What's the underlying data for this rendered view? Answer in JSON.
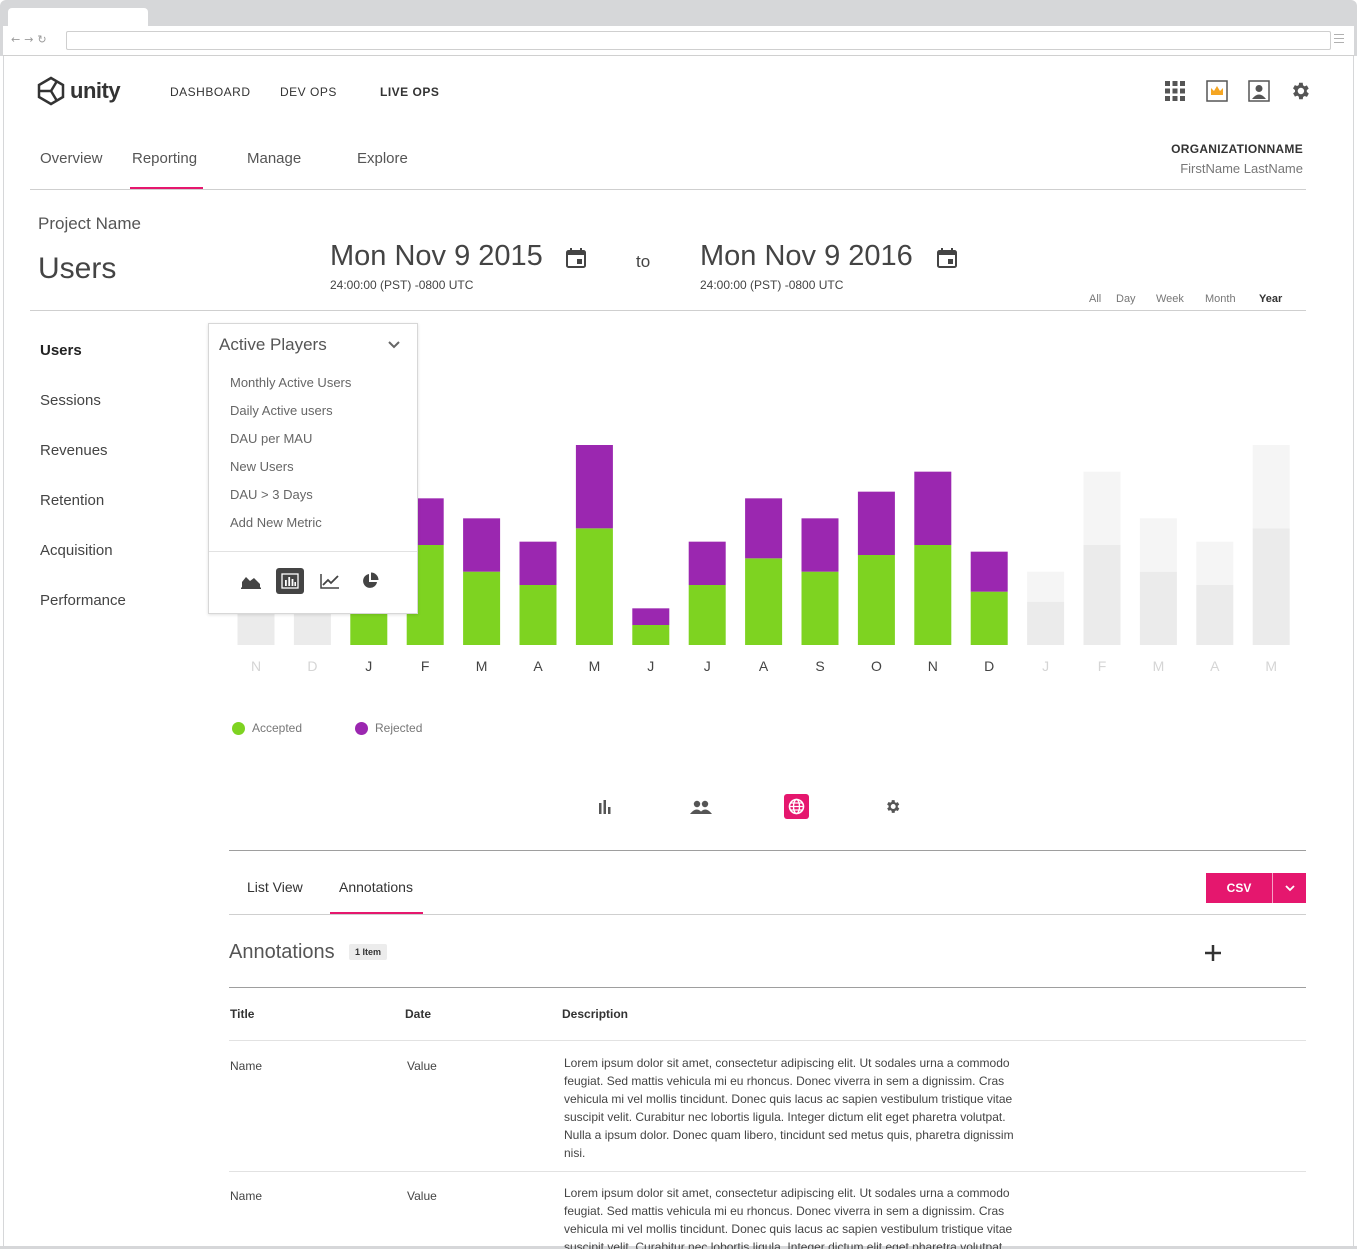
{
  "top_nav": {
    "logo_text": "unity",
    "items": [
      {
        "label": "DASHBOARD",
        "active": false
      },
      {
        "label": "DEV OPS",
        "active": false
      },
      {
        "label": "LIVE OPS",
        "active": true
      }
    ],
    "tools": [
      "apps-grid-icon",
      "crown-icon",
      "account-icon",
      "settings-gear-icon"
    ]
  },
  "sub_nav": {
    "items": [
      {
        "label": "Overview",
        "active": false
      },
      {
        "label": "Reporting",
        "active": true
      },
      {
        "label": "Manage",
        "active": false
      },
      {
        "label": "Explore",
        "active": false
      }
    ]
  },
  "org": {
    "name": "ORGANIZATIONNAME",
    "user": "FirstName LastName"
  },
  "page": {
    "project_name": "Project Name",
    "title": "Users"
  },
  "date_range": {
    "from_date": "Mon Nov 9 2015",
    "from_time": "24:00:00 (PST) -0800 UTC",
    "to_label": "to",
    "to_date": "Mon Nov 9 2016",
    "to_time": "24:00:00 (PST) -0800 UTC"
  },
  "range_options": [
    {
      "label": "All",
      "active": false
    },
    {
      "label": "Day",
      "active": false
    },
    {
      "label": "Week",
      "active": false
    },
    {
      "label": "Month",
      "active": false
    },
    {
      "label": "Year",
      "active": true
    }
  ],
  "sidebar": {
    "items": [
      {
        "label": "Users",
        "active": true
      },
      {
        "label": "Sessions",
        "active": false
      },
      {
        "label": "Revenues",
        "active": false
      },
      {
        "label": "Retention",
        "active": false
      },
      {
        "label": "Acquisition",
        "active": false
      },
      {
        "label": "Performance",
        "active": false
      }
    ]
  },
  "metric_dropdown": {
    "selected": "Active Players",
    "options": [
      "Monthly Active Users",
      "Daily Active users",
      "DAU per MAU",
      "New Users",
      "DAU > 3 Days",
      "Add New Metric"
    ],
    "chart_types": [
      {
        "icon": "area-chart-icon",
        "active": false
      },
      {
        "icon": "bar-chart-icon",
        "active": true
      },
      {
        "icon": "line-chart-icon",
        "active": false
      },
      {
        "icon": "pie-chart-icon",
        "active": false
      }
    ]
  },
  "chart_data": {
    "type": "bar",
    "stacked": true,
    "categories": [
      "N",
      "D",
      "J",
      "F",
      "M",
      "A",
      "M",
      "J",
      "J",
      "A",
      "S",
      "O",
      "N",
      "D",
      "J",
      "F",
      "M",
      "A",
      "M"
    ],
    "in_range": [
      false,
      false,
      true,
      true,
      true,
      true,
      true,
      true,
      true,
      true,
      true,
      true,
      true,
      true,
      false,
      false,
      false,
      false,
      false
    ],
    "series": [
      {
        "name": "Accepted",
        "color": "#7ed321",
        "values": [
          12,
          12,
          12,
          30,
          22,
          18,
          35,
          6,
          18,
          26,
          22,
          27,
          30,
          16,
          13,
          30,
          22,
          18,
          35
        ]
      },
      {
        "name": "Rejected",
        "color": "#9b27b0",
        "values": [
          0,
          0,
          0,
          14,
          16,
          13,
          25,
          5,
          13,
          18,
          16,
          19,
          22,
          12,
          9,
          22,
          16,
          13,
          25
        ]
      }
    ],
    "out_of_range_colors": {
      "lower": "#ebebeb",
      "upper": "#f5f5f5"
    },
    "ylim": [
      0,
      60
    ],
    "grid": false,
    "legend": "bottom-left"
  },
  "view_switch": [
    {
      "icon": "bar-chart-icon",
      "active": false
    },
    {
      "icon": "people-icon",
      "active": false
    },
    {
      "icon": "globe-icon",
      "active": true
    },
    {
      "icon": "settings-gear-icon",
      "active": false
    }
  ],
  "tabs": [
    {
      "label": "List View",
      "active": false
    },
    {
      "label": "Annotations",
      "active": true
    }
  ],
  "csv_button": {
    "label": "CSV"
  },
  "annotations": {
    "title": "Annotations",
    "count_badge": "1 Item",
    "columns": [
      "Title",
      "Date",
      "Description"
    ],
    "rows": [
      {
        "title": "Name",
        "date": "Value",
        "description": "Lorem ipsum dolor sit amet, consectetur adipiscing elit. Ut sodales urna a commodo feugiat. Sed mattis vehicula mi eu rhoncus. Donec viverra in sem a dignissim. Cras vehicula mi vel mollis tincidunt. Donec quis lacus ac sapien vestibulum tristique vitae suscipit velit. Curabitur nec lobortis ligula. Integer dictum elit eget pharetra volutpat. Nulla a ipsum dolor. Donec quam libero, tincidunt sed metus quis, pharetra dignissim nisi."
      },
      {
        "title": "Name",
        "date": "Value",
        "description": "Lorem ipsum dolor sit amet, consectetur adipiscing elit. Ut sodales urna a commodo feugiat. Sed mattis vehicula mi eu rhoncus. Donec viverra in sem a dignissim. Cras vehicula mi vel mollis tincidunt. Donec quis lacus ac sapien vestibulum tristique vitae suscipit velit. Curabitur nec lobortis ligula. Integer dictum elit eget pharetra volutpat. Nulla a ipsum dolor. Donec quam libero, tincidunt sed metus quis, pharetra dignissim nisi."
      }
    ]
  },
  "colors": {
    "accent": "#e5176e",
    "accepted": "#7ed321",
    "rejected": "#9b27b0"
  }
}
